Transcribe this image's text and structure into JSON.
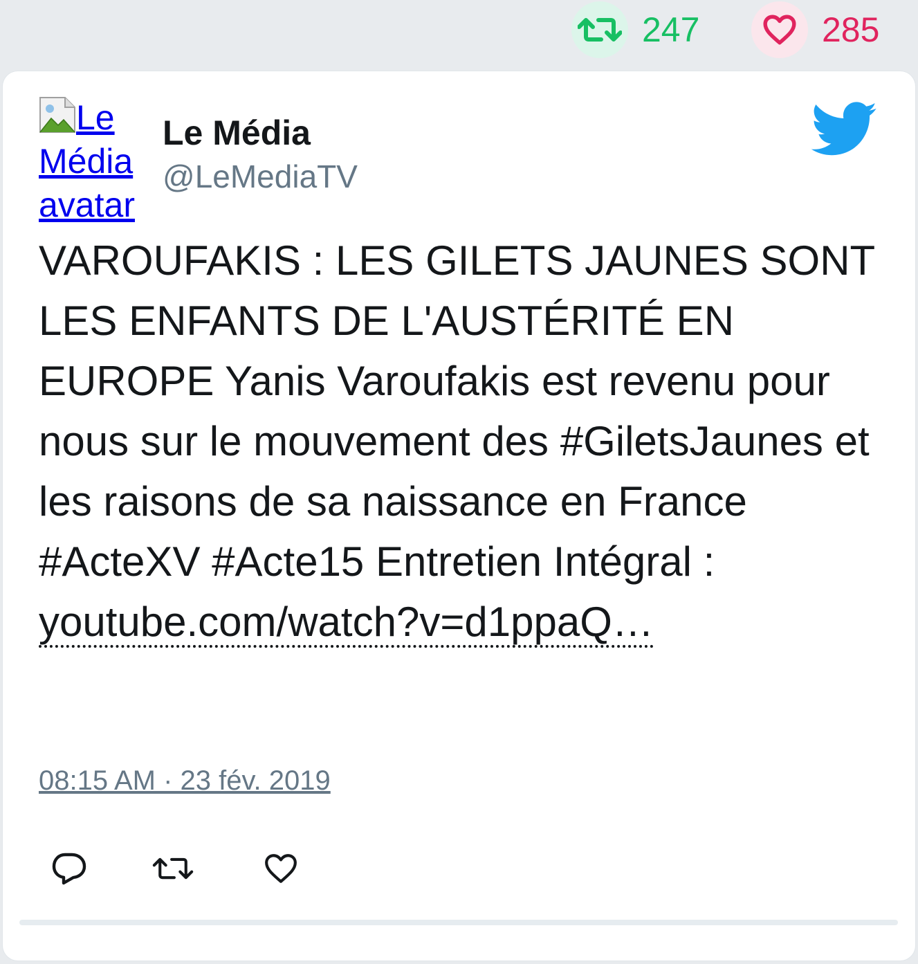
{
  "stats": {
    "retweets": "247",
    "likes": "285"
  },
  "author": {
    "avatar_alt": "Le Média avatar",
    "name": "Le Média",
    "handle": "@LeMediaTV"
  },
  "tweet": {
    "text": "VAROUFAKIS : LES GILETS JAUNES SONT LES ENFANTS DE L'AUSTÉRITÉ EN EUROPE Yanis Varoufakis est revenu pour nous sur le mouvement des #GiletsJaunes et les raisons de sa naissance en France #ActeXV #Acte15 Entretien Intégral : ",
    "link_text": "youtube.com/watch?v=d1ppaQ…",
    "timestamp": "08:15 AM · 23 fév. 2019"
  },
  "icons": {
    "retweet": "retweet-icon",
    "like": "heart-icon",
    "reply": "reply-icon",
    "brand": "twitter-bird-icon"
  },
  "colors": {
    "retweet": "#17bf63",
    "like": "#e0245e",
    "brand": "#1da1f2",
    "muted": "#657786"
  }
}
